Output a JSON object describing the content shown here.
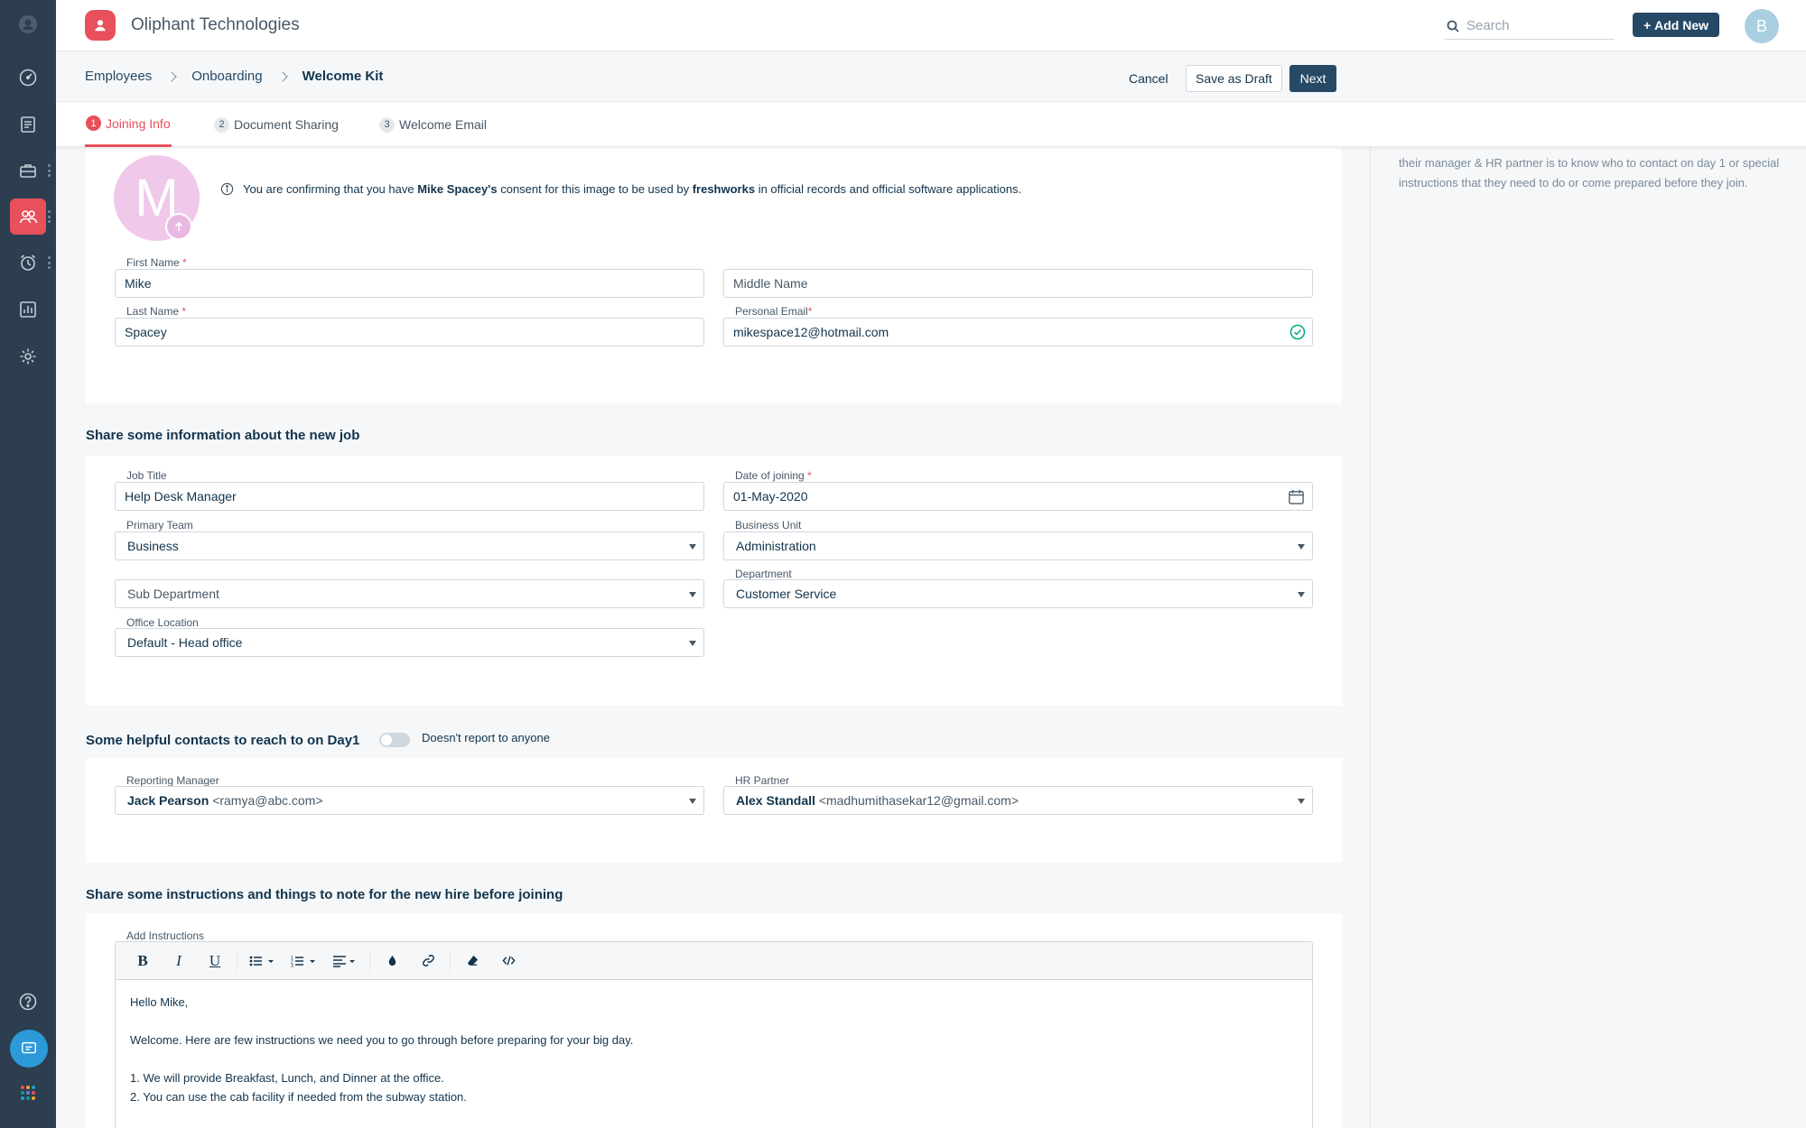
{
  "app": {
    "company": "Oliphant Technologies",
    "search_placeholder": "Search",
    "add_new_label": "Add New",
    "user_initial": "B"
  },
  "breadcrumb": [
    "Employees",
    "Onboarding",
    "Welcome Kit"
  ],
  "actions": {
    "cancel": "Cancel",
    "save_draft": "Save as Draft",
    "next": "Next"
  },
  "tabs": [
    {
      "num": "1",
      "label": "Joining Info",
      "active": true
    },
    {
      "num": "2",
      "label": "Document Sharing",
      "active": false
    },
    {
      "num": "3",
      "label": "Welcome Email",
      "active": false
    }
  ],
  "profile": {
    "avatar_letter": "M",
    "consent_prefix": "You are confirming that you have",
    "consent_name": "Mike Spacey's",
    "consent_mid": "consent for this image to be used by",
    "consent_org": "freshworks",
    "consent_suffix": "in official records and official software applications."
  },
  "personal": {
    "first_name_label": "First Name",
    "first_name": "Mike",
    "middle_name_placeholder": "Middle Name",
    "last_name_label": "Last Name",
    "last_name": "Spacey",
    "email_label": "Personal Email",
    "email": "mikespace12@hotmail.com"
  },
  "job": {
    "section_title": "Share some information about the new job",
    "job_title_label": "Job Title",
    "job_title": "Help Desk Manager",
    "doj_label": "Date of joining",
    "doj": "01-May-2020",
    "primary_team_label": "Primary Team",
    "primary_team": "Business",
    "business_unit_label": "Business Unit",
    "business_unit": "Administration",
    "sub_department_placeholder": "Sub Department",
    "department_label": "Department",
    "department": "Customer Service",
    "office_location_label": "Office Location",
    "office_location": "Default - Head office"
  },
  "contacts": {
    "section_title": "Some helpful contacts to reach to on Day1",
    "toggle_label": "Doesn't report to anyone",
    "toggle_on": false,
    "manager_label": "Reporting Manager",
    "manager_name": "Jack Pearson",
    "manager_email": "<ramya@abc.com>",
    "hr_label": "HR Partner",
    "hr_name": "Alex Standall",
    "hr_email": "<madhumithasekar12@gmail.com>"
  },
  "instructions": {
    "section_title": "Share some instructions and things to note for the new hire before joining",
    "editor_label": "Add Instructions",
    "lines": [
      "Hello Mike,",
      "",
      "Welcome. Here are few instructions we need you to go through before preparing for your big day.",
      "",
      "1. We will provide Breakfast, Lunch, and Dinner at the office.",
      "2. You can use the cab facility if needed from the subway station."
    ]
  },
  "side_panel": {
    "text": "their manager & HR partner is to know who to contact on day 1 or special instructions that they need to do or come prepared before they join."
  },
  "colors": {
    "accent": "#e8505b",
    "primary": "#264966",
    "rail": "#2c3e50",
    "avatar_bg": "#f0c8ea",
    "success": "#00a886"
  }
}
